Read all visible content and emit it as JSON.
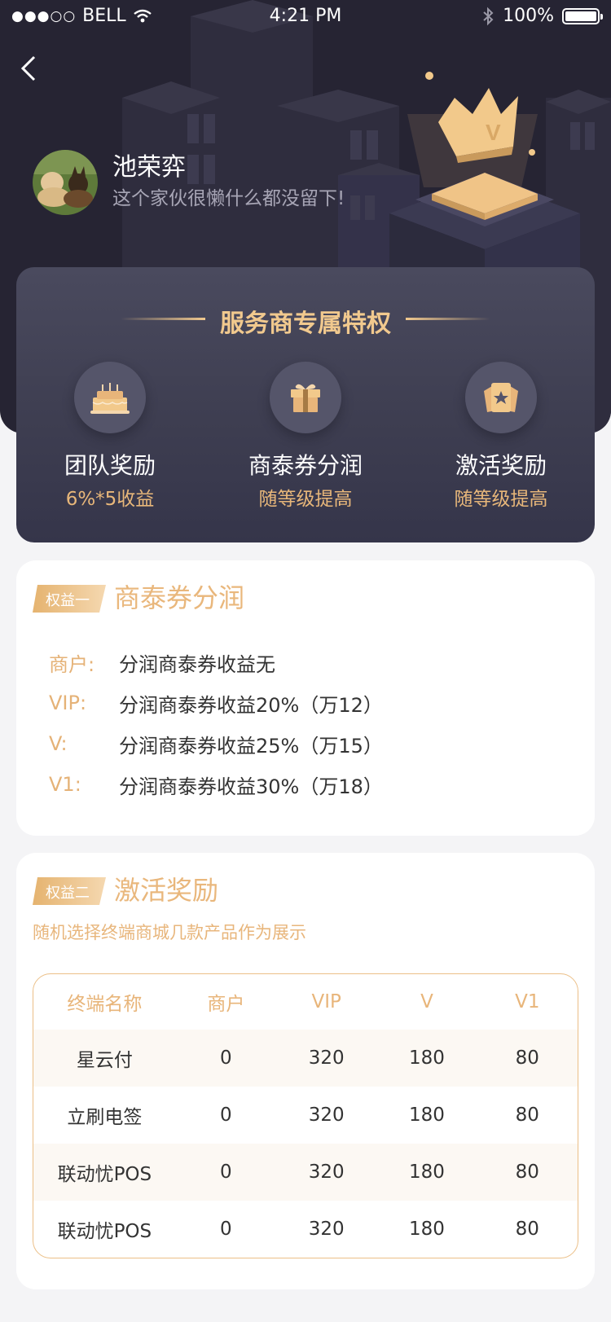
{
  "status_bar": {
    "signal_dots": "●●●○○",
    "carrier": "BELL",
    "time": "4:21 PM",
    "battery_percent": "100%"
  },
  "profile": {
    "name": "池荣弈",
    "bio": "这个家伙很懒什么都没留下!"
  },
  "privileges": {
    "title": "服务商专属特权",
    "features": [
      {
        "icon": "cake-icon",
        "name": "团队奖励",
        "sub": "6%*5收益"
      },
      {
        "icon": "gift-icon",
        "name": "商泰券分润",
        "sub": "随等级提高"
      },
      {
        "icon": "ticket-icon",
        "name": "激活奖励",
        "sub": "随等级提高"
      }
    ]
  },
  "benefit1": {
    "tag": "权益一",
    "title": "商泰券分润",
    "rows": [
      {
        "level": "商户:",
        "desc": "分润商泰券收益无"
      },
      {
        "level": "VIP:",
        "desc": "分润商泰券收益20%（万12）"
      },
      {
        "level": "V:",
        "desc": "分润商泰券收益25%（万15）"
      },
      {
        "level": "V1:",
        "desc": "分润商泰券收益30%（万18）"
      }
    ]
  },
  "benefit2": {
    "tag": "权益二",
    "title": "激活奖励",
    "note": "随机选择终端商城几款产品作为展示",
    "table": {
      "headers": [
        "终端名称",
        "商户",
        "VIP",
        "V",
        "V1"
      ],
      "rows": [
        [
          "星云付",
          "0",
          "320",
          "180",
          "80"
        ],
        [
          "立刷电签",
          "0",
          "320",
          "180",
          "80"
        ],
        [
          "联动忧POS",
          "0",
          "320",
          "180",
          "80"
        ],
        [
          "联动忧POS",
          "0",
          "320",
          "180",
          "80"
        ]
      ]
    }
  },
  "colors": {
    "accent": "#e8b57a",
    "dark_bg": "#262433",
    "card_bg": "#3e3e51"
  }
}
